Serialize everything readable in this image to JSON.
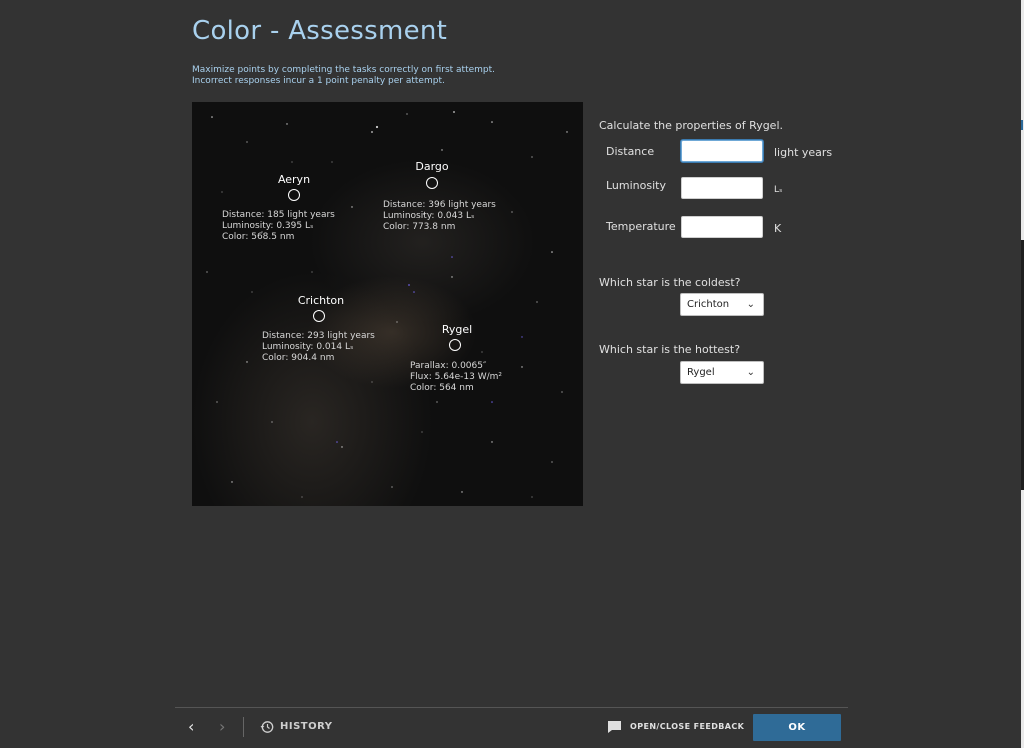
{
  "title": "Color - Assessment",
  "instructions": [
    "Maximize points by completing the tasks correctly on first attempt.",
    "Incorrect responses incur a 1 point penalty per attempt."
  ],
  "stars": {
    "aeryn": {
      "name": "Aeryn",
      "lines": [
        "Distance: 185 light years",
        "Luminosity: 0.395 Lₛ",
        "Color: 568.5 nm"
      ]
    },
    "dargo": {
      "name": "Dargo",
      "lines": [
        "Distance: 396 light years",
        "Luminosity: 0.043 Lₛ",
        "Color: 773.8 nm"
      ]
    },
    "crichton": {
      "name": "Crichton",
      "lines": [
        "Distance: 293 light years",
        "Luminosity: 0.014 Lₛ",
        "Color: 904.4 nm"
      ]
    },
    "rygel": {
      "name": "Rygel",
      "lines": [
        "Parallax: 0.0065″",
        "Flux: 5.64e-13 W/m²",
        "Color: 564 nm"
      ]
    }
  },
  "question": {
    "prompt": "Calculate the properties of Rygel.",
    "fields": {
      "distance": {
        "label": "Distance",
        "value": "",
        "unit": "light years"
      },
      "luminosity": {
        "label": "Luminosity",
        "value": "",
        "unit": "Lₛ"
      },
      "temperature": {
        "label": "Temperature",
        "value": "",
        "unit": "K"
      }
    },
    "coldest": {
      "prompt": "Which star is the coldest?",
      "selected": "Crichton"
    },
    "hottest": {
      "prompt": "Which star is the hottest?",
      "selected": "Rygel"
    }
  },
  "footer": {
    "back_icon": "‹",
    "forward_icon": "›",
    "history_label": "HISTORY",
    "feedback_label": "OPEN/CLOSE FEEDBACK",
    "ok_label": "OK"
  },
  "colors": {
    "title": "#a9d1ee",
    "accent_button": "#2f6b97",
    "background": "#333333"
  },
  "icons": {
    "history": "history-icon",
    "feedback": "feedback-icon",
    "dropdown": "chevron-down-icon"
  }
}
